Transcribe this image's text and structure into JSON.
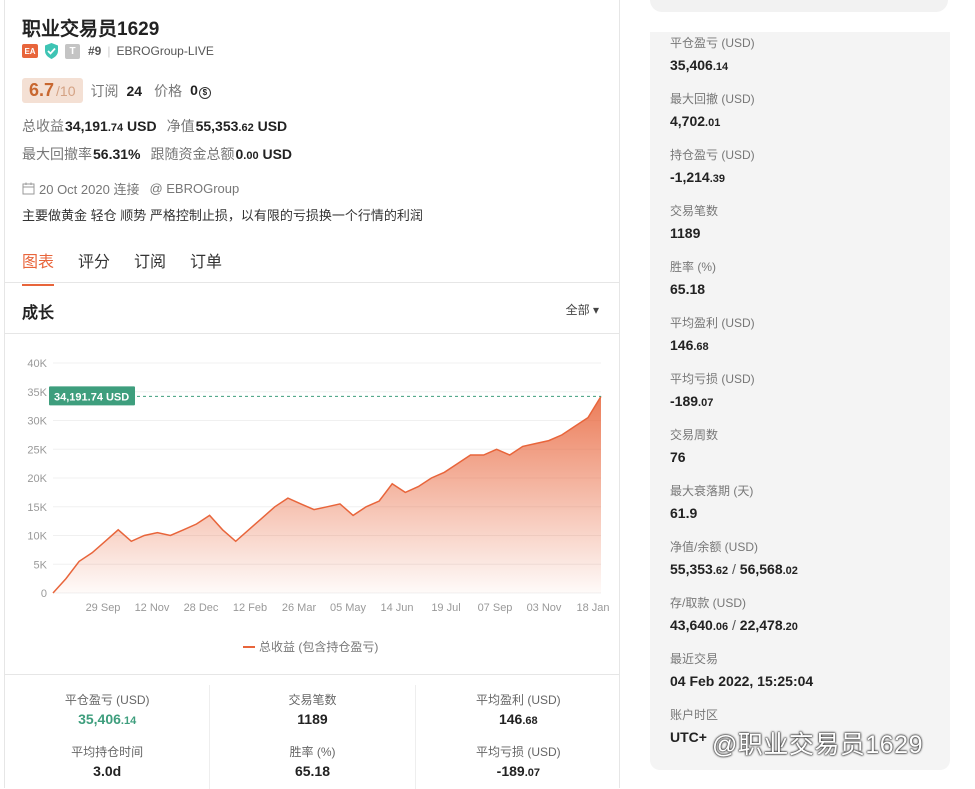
{
  "profile": {
    "name": "职业交易员1629",
    "badge_ea": "EA",
    "badge_t": "T",
    "rank": "#9",
    "server": "EBROGroup-LIVE",
    "score": "6.7",
    "score_max": "/10",
    "subscribe_label": "订阅",
    "subscribe_count": "24",
    "price_label": "价格",
    "price_value": "0",
    "total_profit_label": "总收益",
    "total_profit_main": "34,191",
    "total_profit_dec": ".74",
    "total_profit_unit": "USD",
    "equity_label": "净值",
    "equity_main": "55,353",
    "equity_dec": ".62",
    "equity_unit": "USD",
    "max_dd_label": "最大回撤率",
    "max_dd_value": "56.31%",
    "follow_label": "跟随资金总额",
    "follow_main": "0",
    "follow_dec": ".00",
    "follow_unit": "USD",
    "connect_date": "20 Oct 2020 连接",
    "connect_broker": "@ EBROGroup",
    "description": "主要做黄金 轻仓 顺势  严格控制止损，以有限的亏损换一个行情的利润"
  },
  "tabs": [
    "图表",
    "评分",
    "订阅",
    "订单"
  ],
  "growth": {
    "title": "成长",
    "range": "全部 ▾",
    "legend": "总收益 (包含持仓盈亏)",
    "current_label": "34,191.74 USD"
  },
  "chart_data": {
    "type": "area",
    "title": "",
    "ylim": [
      0,
      40000
    ],
    "y_ticks": [
      "0",
      "5K",
      "10K",
      "15K",
      "20K",
      "25K",
      "30K",
      "35K",
      "40K"
    ],
    "x_ticks": [
      "29 Sep",
      "12 Nov",
      "28 Dec",
      "12 Feb",
      "26 Mar",
      "05 May",
      "14 Jun",
      "19 Jul",
      "07 Sep",
      "03 Nov",
      "18 Jan"
    ],
    "series": [
      {
        "name": "总收益 (包含持仓盈亏)",
        "x": [
          0,
          1,
          2,
          3,
          4,
          5,
          6,
          7,
          8,
          9,
          10,
          11,
          12,
          13,
          14,
          15,
          16,
          17,
          18,
          19,
          20,
          21,
          22,
          23,
          24,
          25,
          26,
          27,
          28,
          29,
          30,
          31,
          32,
          33,
          34,
          35,
          36,
          37,
          38,
          39,
          40,
          41,
          42
        ],
        "values": [
          0,
          2500,
          5500,
          7000,
          9000,
          11000,
          9000,
          10000,
          10500,
          10000,
          11000,
          12000,
          13500,
          11000,
          9000,
          11000,
          13000,
          15000,
          16500,
          15500,
          14500,
          15000,
          15500,
          13500,
          15000,
          16000,
          19000,
          17500,
          18500,
          20000,
          21000,
          22500,
          24000,
          24000,
          25000,
          24000,
          25500,
          26000,
          26500,
          27500,
          29000,
          30500,
          34191
        ]
      }
    ],
    "grid": true,
    "colors": {
      "line": "#e8653b",
      "label_bg": "#3e9e7d"
    }
  },
  "bottom_stats": [
    {
      "label": "平仓盈亏 (USD)",
      "main": "35,406",
      "dec": ".14",
      "color": "green"
    },
    {
      "label": "交易笔数",
      "main": "1189",
      "dec": "",
      "color": ""
    },
    {
      "label": "平均盈利 (USD)",
      "main": "146",
      "dec": ".68",
      "color": ""
    },
    {
      "label": "平均持仓时间",
      "main": "3.0d",
      "dec": "",
      "color": ""
    },
    {
      "label": "胜率 (%)",
      "main": "65.18",
      "dec": "",
      "color": ""
    },
    {
      "label": "平均亏损 (USD)",
      "main": "-189",
      "dec": ".07",
      "color": ""
    }
  ],
  "side_stats": [
    {
      "label": "平仓盈亏 (USD)",
      "main": "35,406",
      "dec": ".14",
      "color": "green"
    },
    {
      "label": "最大回撤 (USD)",
      "main": "4,702",
      "dec": ".01",
      "color": ""
    },
    {
      "label": "持仓盈亏 (USD)",
      "main": "-1,214",
      "dec": ".39",
      "color": "red"
    },
    {
      "label": "交易笔数",
      "main": "1189",
      "dec": "",
      "color": ""
    },
    {
      "label": "胜率 (%)",
      "main": "65.18",
      "dec": "",
      "color": ""
    },
    {
      "label": "平均盈利 (USD)",
      "main": "146",
      "dec": ".68",
      "color": ""
    },
    {
      "label": "平均亏损 (USD)",
      "main": "-189",
      "dec": ".07",
      "color": ""
    },
    {
      "label": "交易周数",
      "main": "76",
      "dec": "",
      "color": ""
    },
    {
      "label": "最大衰落期 (天)",
      "main": "61.9",
      "dec": "",
      "color": ""
    },
    {
      "label": "净值/余额 (USD)",
      "main": "55,353",
      "dec": ".62",
      "main2": "56,568",
      "dec2": ".02",
      "color": ""
    },
    {
      "label": "存/取款 (USD)",
      "main": "43,640",
      "dec": ".06",
      "main2": "22,478",
      "dec2": ".20",
      "color": ""
    },
    {
      "label": "最近交易",
      "main": "04 Feb 2022, 15:25:04",
      "dec": "",
      "color": ""
    },
    {
      "label": "账户时区",
      "main": "UTC+",
      "dec": "",
      "color": ""
    }
  ],
  "watermark": "@职业交易员1629"
}
